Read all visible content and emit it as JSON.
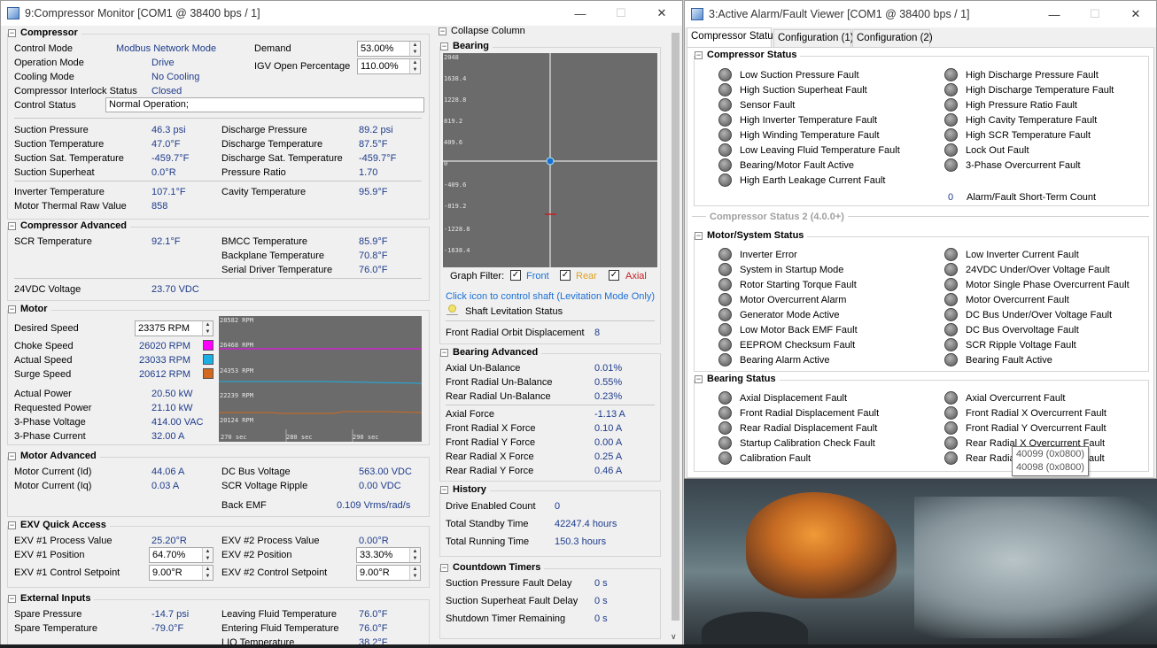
{
  "left_window": {
    "title": "9:Compressor Monitor [COM1 @ 38400 bps / 1]",
    "compressor": {
      "header": "Compressor",
      "control_mode_label": "Control Mode",
      "control_mode": "Modbus Network Mode",
      "operation_mode_label": "Operation Mode",
      "operation_mode": "Drive",
      "cooling_mode_label": "Cooling Mode",
      "cooling_mode": "No Cooling",
      "interlock_label": "Compressor Interlock Status",
      "interlock": "Closed",
      "control_status_label": "Control Status",
      "control_status": "Normal Operation;",
      "demand_label": "Demand",
      "demand": "53.00%",
      "igv_label": "IGV Open Percentage",
      "igv": "110.00%",
      "suction_pressure_label": "Suction Pressure",
      "suction_pressure": "46.3 psi",
      "suction_temp_label": "Suction Temperature",
      "suction_temp": "47.0°F",
      "suction_sat_label": "Suction Sat. Temperature",
      "suction_sat": "-459.7°F",
      "suction_superheat_label": "Suction Superheat",
      "suction_superheat": "0.0°R",
      "discharge_pressure_label": "Discharge Pressure",
      "discharge_pressure": "89.2 psi",
      "discharge_temp_label": "Discharge Temperature",
      "discharge_temp": "87.5°F",
      "discharge_sat_label": "Discharge Sat. Temperature",
      "discharge_sat": "-459.7°F",
      "pressure_ratio_label": "Pressure Ratio",
      "pressure_ratio": "1.70",
      "inverter_temp_label": "Inverter Temperature",
      "inverter_temp": "107.1°F",
      "motor_thermal_label": "Motor Thermal Raw Value",
      "motor_thermal": "858",
      "cavity_temp_label": "Cavity Temperature",
      "cavity_temp": "95.9°F"
    },
    "compressor_advanced": {
      "header": "Compressor Advanced",
      "scr_temp_label": "SCR Temperature",
      "scr_temp": "92.1°F",
      "bmcc_label": "BMCC Temperature",
      "bmcc": "85.9°F",
      "backplane_label": "Backplane Temperature",
      "backplane": "70.8°F",
      "serial_driver_label": "Serial Driver Temperature",
      "serial_driver": "76.0°F",
      "vdc_label": "24VDC Voltage",
      "vdc": "23.70 VDC"
    },
    "motor": {
      "header": "Motor",
      "desired_speed_label": "Desired Speed",
      "desired_speed": "23375 RPM",
      "choke_label": "Choke Speed",
      "choke": "26020 RPM",
      "choke_color": "#ff00ff",
      "actual_label": "Actual Speed",
      "actual": "23033 RPM",
      "actual_color": "#1ab0e6",
      "surge_label": "Surge Speed",
      "surge": "20612 RPM",
      "surge_color": "#d2691e",
      "actual_power_label": "Actual Power",
      "actual_power": "20.50 kW",
      "requested_power_label": "Requested Power",
      "requested_power": "21.10 kW",
      "phase_voltage_label": "3-Phase Voltage",
      "phase_voltage": "414.00 VAC",
      "phase_current_label": "3-Phase Current",
      "phase_current": "32.00 A",
      "graph": {
        "y_labels": [
          "28582 RPM",
          "26468 RPM",
          "24353 RPM",
          "22239 RPM",
          "20124 RPM"
        ],
        "x_labels": [
          "270 sec",
          "280 sec",
          "290 sec"
        ]
      }
    },
    "motor_advanced": {
      "header": "Motor Advanced",
      "id_label": "Motor Current (Id)",
      "id": "44.06 A",
      "iq_label": "Motor Current (Iq)",
      "iq": "0.03 A",
      "dc_bus_label": "DC Bus Voltage",
      "dc_bus": "563.00 VDC",
      "scr_ripple_label": "SCR Voltage Ripple",
      "scr_ripple": "0.00 VDC",
      "back_emf_label": "Back EMF",
      "back_emf": "0.109 Vrms/rad/s"
    },
    "exv": {
      "header": "EXV Quick Access",
      "exv1_pv_label": "EXV #1 Process Value",
      "exv1_pv": "25.20°R",
      "exv1_pos_label": "EXV #1 Position",
      "exv1_pos": "64.70%",
      "exv1_sp_label": "EXV #1 Control Setpoint",
      "exv1_sp": "9.00°R",
      "exv2_pv_label": "EXV #2 Process Value",
      "exv2_pv": "0.00°R",
      "exv2_pos_label": "EXV #2 Position",
      "exv2_pos": "33.30%",
      "exv2_sp_label": "EXV #2 Control Setpoint",
      "exv2_sp": "9.00°R"
    },
    "external": {
      "header": "External Inputs",
      "spare_pressure_label": "Spare Pressure",
      "spare_pressure": "-14.7 psi",
      "spare_temp_label": "Spare Temperature",
      "spare_temp": "-79.0°F",
      "leaving_label": "Leaving Fluid Temperature",
      "leaving": "76.0°F",
      "entering_label": "Entering Fluid Temperature",
      "entering": "76.0°F",
      "lio_label": "LIQ Temperature",
      "lio": "38.2°F"
    },
    "collapse_label": "Collapse Column",
    "bearing": {
      "header": "Bearing",
      "y_labels": [
        "2048",
        "1638.4",
        "1228.8",
        "819.2",
        "409.6",
        "0",
        "-409.6",
        "-819.2",
        "-1228.8",
        "-1638.4"
      ],
      "filter_label": "Graph Filter:",
      "front": "Front",
      "rear": "Rear",
      "axial": "Axial",
      "front_color": "#1a6fd6",
      "rear_color": "#e0a020",
      "axial_color": "#c81e1e",
      "click_hint": "Click icon to control shaft (Levitation Mode Only)",
      "levitation": "Shaft Levitation Status",
      "orbit_label": "Front Radial Orbit Displacement",
      "orbit": "8"
    },
    "bearing_advanced": {
      "header": "Bearing Advanced",
      "axial_unbal_label": "Axial Un-Balance",
      "axial_unbal": "0.01%",
      "front_unbal_label": "Front Radial Un-Balance",
      "front_unbal": "0.55%",
      "rear_unbal_label": "Rear Radial Un-Balance",
      "rear_unbal": "0.23%",
      "axial_force_label": "Axial Force",
      "axial_force": "-1.13 A",
      "frx_label": "Front Radial X Force",
      "frx": "0.10 A",
      "fry_label": "Front Radial Y Force",
      "fry": "0.00 A",
      "rrx_label": "Rear Radial X Force",
      "rrx": "0.25 A",
      "rry_label": "Rear Radial Y Force",
      "rry": "0.46 A"
    },
    "history": {
      "header": "History",
      "drive_count_label": "Drive Enabled Count",
      "drive_count": "0",
      "standby_label": "Total Standby Time",
      "standby": "42247.4 hours",
      "running_label": "Total Running Time",
      "running": "150.3 hours"
    },
    "countdown": {
      "header": "Countdown Timers",
      "suction_delay_label": "Suction Pressure Fault Delay",
      "suction_delay": "0 s",
      "superheat_delay_label": "Suction Superheat Fault Delay",
      "superheat_delay": "0 s",
      "shutdown_label": "Shutdown Timer Remaining",
      "shutdown": "0 s"
    }
  },
  "right_window": {
    "title": "3:Active Alarm/Fault Viewer [COM1 @ 38400 bps / 1]",
    "tabs": [
      "Compressor Status",
      "Configuration (1)",
      "Configuration (2)"
    ],
    "compressor_status": {
      "header": "Compressor Status",
      "left": [
        "Low Suction Pressure Fault",
        "High Suction Superheat Fault",
        "Sensor Fault",
        "High Inverter Temperature Fault",
        "High Winding Temperature Fault",
        "Low Leaving Fluid Temperature Fault",
        "Bearing/Motor Fault Active",
        "High Earth Leakage Current Fault"
      ],
      "right": [
        "High Discharge Pressure Fault",
        "High Discharge Temperature Fault",
        "High Pressure Ratio Fault",
        "High Cavity Temperature Fault",
        "High SCR Temperature Fault",
        "Lock Out Fault",
        "3-Phase Overcurrent Fault"
      ],
      "count": "0",
      "count_label": "Alarm/Fault Short-Term Count"
    },
    "status2_header": "Compressor Status 2 (4.0.0+)",
    "motor_system": {
      "header": "Motor/System Status",
      "left": [
        "Inverter Error",
        "System in Startup Mode",
        "Rotor Starting Torque Fault",
        "Motor Overcurrent Alarm",
        "Generator Mode Active",
        "Low Motor Back EMF Fault",
        "EEPROM Checksum Fault",
        "Bearing Alarm Active"
      ],
      "right": [
        "Low Inverter Current Fault",
        "24VDC Under/Over Voltage Fault",
        "Motor Single Phase Overcurrent Fault",
        "Motor Overcurrent Fault",
        "DC Bus Under/Over Voltage Fault",
        "DC Bus Overvoltage Fault",
        "SCR Ripple Voltage Fault",
        "Bearing Fault Active"
      ]
    },
    "bearing_status": {
      "header": "Bearing Status",
      "left": [
        "Axial Displacement Fault",
        "Front Radial Displacement Fault",
        "Rear Radial Displacement Fault",
        "Startup Calibration Check Fault",
        "Calibration Fault"
      ],
      "right": [
        "Axial Overcurrent Fault",
        "Front Radial X Overcurrent Fault",
        "Front Radial Y Overcurrent Fault",
        "Rear Radial X Overcurrent Fault",
        "Rear Radial Y Overcurrent Fault"
      ]
    },
    "tooltip": [
      "40099 (0x0800)",
      "40098 (0x0800)"
    ]
  }
}
